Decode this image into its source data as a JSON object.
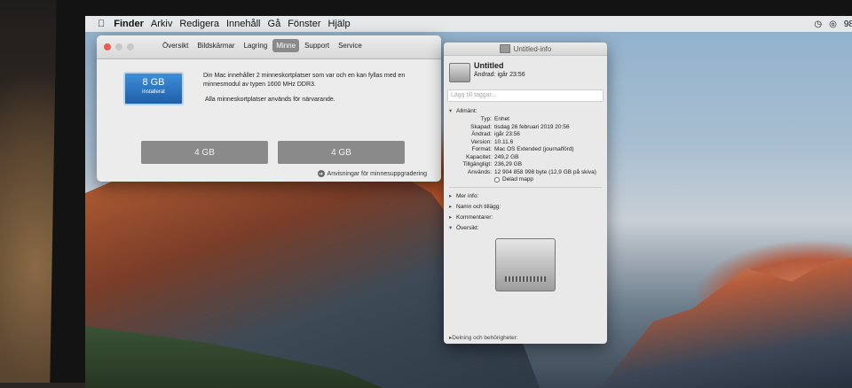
{
  "menubar": {
    "items": [
      "Finder",
      "Arkiv",
      "Redigera",
      "Innehåll",
      "Gå",
      "Fönster",
      "Hjälp"
    ],
    "battery": "98"
  },
  "sysinfo": {
    "tabs": [
      "Översikt",
      "Bildskärmar",
      "Lagring",
      "Minne",
      "Support",
      "Service"
    ],
    "active_tab": "Minne",
    "badge": {
      "size": "8 GB",
      "label": "installerat"
    },
    "description": "Din Mac innehåller 2 minneskortplatser som var och en kan fyllas med en minnesmodul av typen 1600 MHz DDR3.",
    "status": "Alla minneskortplatser används för närvarande.",
    "slots": [
      "4 GB",
      "4 GB"
    ],
    "link": "Anvisningar för minnesuppgradering"
  },
  "info": {
    "window_title": "Untitled-info",
    "name": "Untitled",
    "modified": "Ändrad: igår 23:56",
    "tags_placeholder": "Lägg till taggar...",
    "general_header": "Allmänt:",
    "general": [
      {
        "k": "Typ:",
        "v": "Enhet"
      },
      {
        "k": "Skapad:",
        "v": "tisdag 26 februari 2019 20:56"
      },
      {
        "k": "Ändrad:",
        "v": "igår 23:56"
      },
      {
        "k": "Version:",
        "v": "10.11.6"
      },
      {
        "k": "Format:",
        "v": "Mac OS Extended (journalförd)"
      },
      {
        "k": "Kapacitet:",
        "v": "249,2 GB"
      },
      {
        "k": "Tillgängligt:",
        "v": "236,29 GB"
      },
      {
        "k": "Används:",
        "v": "12 904 858 998 byte (12,9 GB på skiva)"
      }
    ],
    "shared_folder": "Delad mapp",
    "sections": [
      "Mer info:",
      "Namn och tillägg:",
      "Kommentarer:",
      "Översikt:"
    ],
    "footer": "Delning och behörigheter:"
  }
}
